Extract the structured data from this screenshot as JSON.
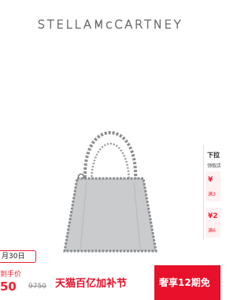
{
  "brand": {
    "logo_text": "STELLAMcCARTNEY"
  },
  "product": {
    "image_alt": "grey chain-trim tote bag"
  },
  "promo_panel": {
    "title": "下拉",
    "subtitle": "领取店",
    "coupons": [
      {
        "amount": "¥",
        "condition": "满3"
      },
      {
        "amount": "¥2",
        "condition": "满6"
      }
    ]
  },
  "date_tag": "月30日",
  "price": {
    "label": "到手价",
    "current": "50",
    "original": "9750"
  },
  "banner": {
    "event_text": "天猫百亿加补节",
    "perk_text": "奢享12期免"
  },
  "colors": {
    "accent": "#e8102a",
    "bag": "#c9cbcc",
    "chain": "#8a8d90"
  }
}
